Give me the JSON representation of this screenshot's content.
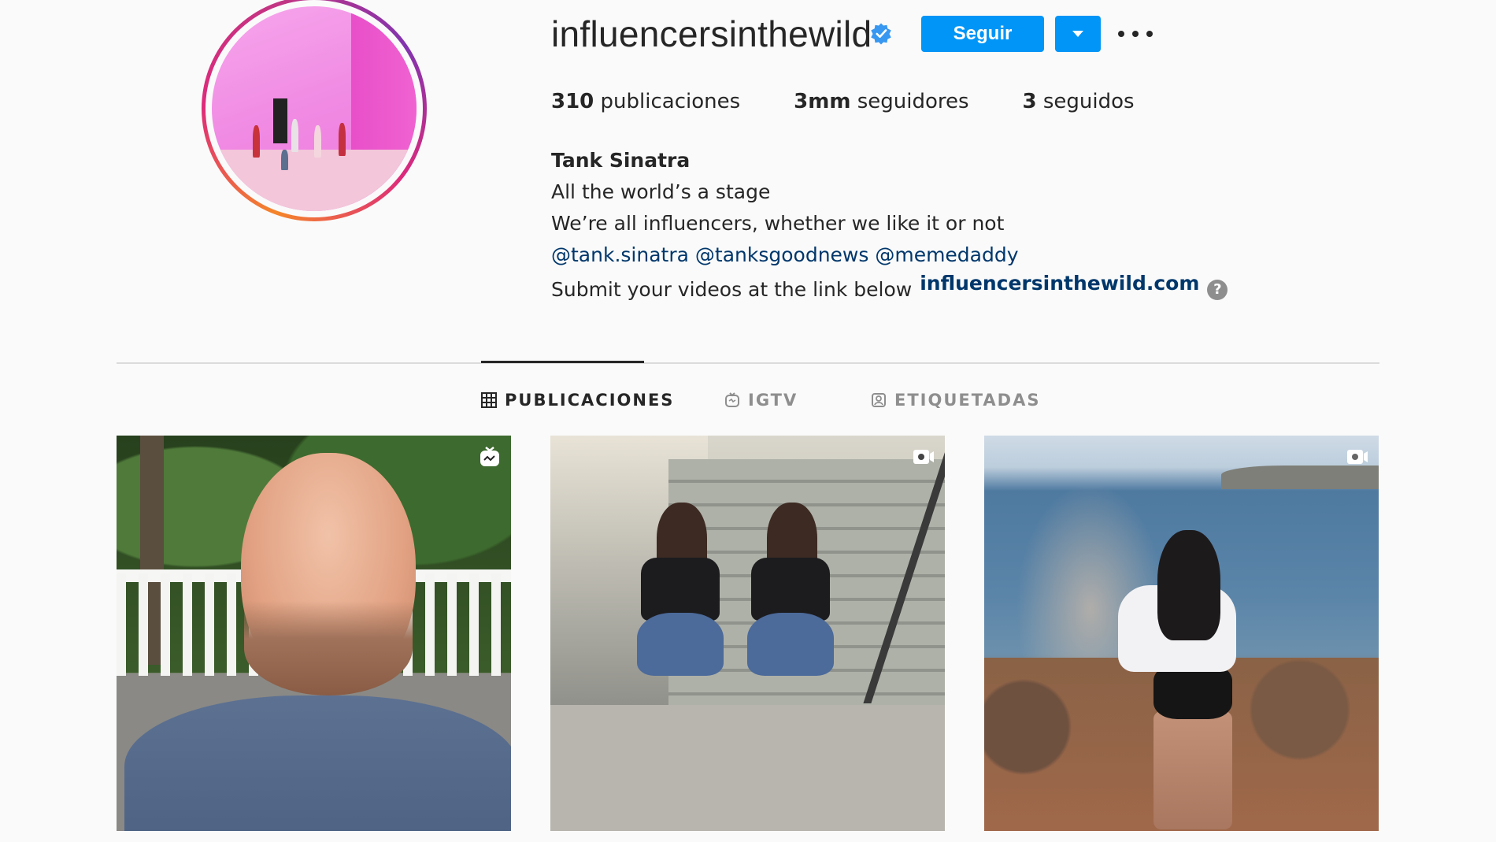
{
  "profile": {
    "username": "influencersinthewild",
    "verified": true,
    "follow_label": "Seguir",
    "stats": {
      "posts_count": "310",
      "posts_label": "publicaciones",
      "followers_count": "3mm",
      "followers_label": "seguidores",
      "following_count": "3",
      "following_label": "seguidos"
    },
    "bio": {
      "full_name": "Tank Sinatra",
      "line1": "All the world’s a stage",
      "line2": "We’re all influencers, whether we like it or not",
      "mentions": [
        "@tank.sinatra",
        "@tanksgoodnews",
        "@memedaddy"
      ],
      "link_prefix": "Submit your videos at the link below",
      "external_link": "influencersinthewild.com",
      "help_glyph": "?"
    }
  },
  "tabs": [
    {
      "label": "PUBLICACIONES",
      "icon": "grid-icon",
      "active": true
    },
    {
      "label": "IGTV",
      "icon": "igtv-icon",
      "active": false
    },
    {
      "label": "ETIQUETADAS",
      "icon": "tagged-icon",
      "active": false
    }
  ],
  "posts": [
    {
      "type_icon": "igtv-icon",
      "subject": "man selfie video"
    },
    {
      "type_icon": "video-icon",
      "subject": "two girls on steps"
    },
    {
      "type_icon": "video-icon",
      "subject": "girl photographing by the sea"
    }
  ],
  "colors": {
    "accent": "#0095f6",
    "link": "#00376b",
    "text": "#262626",
    "muted": "#8e8e8e",
    "background": "#fafafa"
  }
}
